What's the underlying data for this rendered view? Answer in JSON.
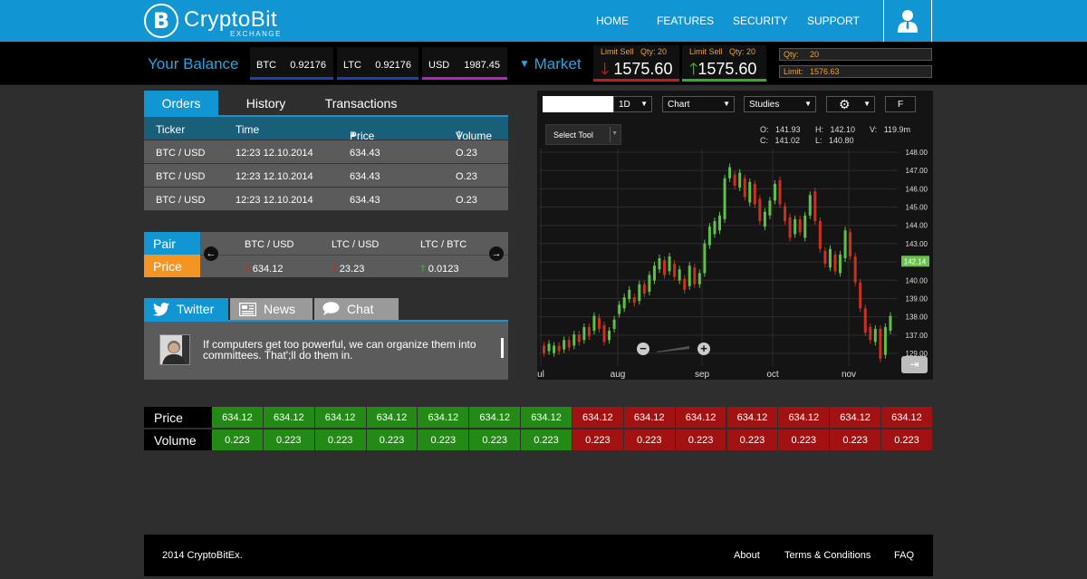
{
  "header": {
    "logo_symbol": "B",
    "logo_text": "CryptoBit",
    "logo_sub": "EXCHANGE",
    "nav": [
      "HOME",
      "FEATURES",
      "SECURITY",
      "SUPPORT"
    ]
  },
  "balance": {
    "title": "Your Balance",
    "items": [
      {
        "currency": "BTC",
        "amount": "0.92176",
        "color": "#1e3fb5"
      },
      {
        "currency": "LTC",
        "amount": "0.92176",
        "color": "#1e3fb5"
      },
      {
        "currency": "USD",
        "amount": "1987.45",
        "color": "#b522c8"
      }
    ],
    "market_label": "Market",
    "limit_sell": {
      "label": "Limit Sell",
      "qty": "Qty: 20",
      "value": "1575.60"
    },
    "limit_buy": {
      "label": "Limit Sell",
      "qty": "Qty: 20",
      "value": "1575.60"
    },
    "qty_field": {
      "label": "Qty:",
      "value": "20"
    },
    "limit_field": {
      "label": "Limit:",
      "value": "1576.63"
    }
  },
  "orders": {
    "tabs": [
      "Orders",
      "History",
      "Transactions"
    ],
    "columns": [
      "Ticker",
      "Time",
      "Price",
      "Volume"
    ],
    "rows": [
      [
        "BTC / USD",
        "12:23 12.10.2014",
        "634.43",
        "O.23"
      ],
      [
        "BTC / USD",
        "12:23 12.10.2014",
        "634.43",
        "O.23"
      ],
      [
        "BTC / USD",
        "12:23 12.10.2014",
        "634.43",
        "O.23"
      ]
    ]
  },
  "pairs": {
    "pair_label": "Pair",
    "price_label": "Price",
    "items": [
      {
        "pair": "BTC / USD",
        "price": "634.12",
        "dir": "down"
      },
      {
        "pair": "LTC / USD",
        "price": "23.23",
        "dir": "down"
      },
      {
        "pair": "LTC / BTC",
        "price": "0.0123",
        "dir": "up"
      }
    ]
  },
  "feed": {
    "tabs": [
      "Twitter",
      "News",
      "Chat"
    ],
    "message": "If computers get too powerful, we can organize them into committees. That';ll do them in."
  },
  "chart_controls": {
    "interval": "1D",
    "chart_type": "Chart",
    "studies": "Studies",
    "fullscreen": "F",
    "select_tool": "Select Tool",
    "ohlc": {
      "o": "141.93",
      "h": "142.10",
      "v": "119.9m",
      "c": "141.02",
      "l": "140.80"
    },
    "o_label": "O:",
    "h_label": "H:",
    "v_label": "V:",
    "c_label": "C:",
    "l_label": "L:"
  },
  "chart_data": {
    "type": "candlestick",
    "x_ticks": [
      "ul",
      "aug",
      "sep",
      "oct",
      "nov"
    ],
    "y_ticks": [
      "148.00",
      "147.00",
      "146.00",
      "145.00",
      "144.00",
      "143.00",
      "141.00",
      "140.00",
      "139.00",
      "138.00",
      "137.00",
      "129.00"
    ],
    "current_price": "142.14",
    "ylim": [
      136.5,
      148.1
    ],
    "candles": [
      {
        "o": 137.6,
        "c": 137.2
      },
      {
        "o": 137.3,
        "c": 137.7
      },
      {
        "o": 137.2,
        "c": 137.6
      },
      {
        "o": 137.6,
        "c": 137.3
      },
      {
        "o": 137.4,
        "c": 137.9
      },
      {
        "o": 137.9,
        "c": 137.5
      },
      {
        "o": 137.6,
        "c": 138.2
      },
      {
        "o": 138.2,
        "c": 137.8
      },
      {
        "o": 137.9,
        "c": 138.6
      },
      {
        "o": 138.6,
        "c": 138.1
      },
      {
        "o": 138.4,
        "c": 139.2
      },
      {
        "o": 139.1,
        "c": 138.5
      },
      {
        "o": 138.7,
        "c": 137.8
      },
      {
        "o": 137.9,
        "c": 138.4
      },
      {
        "o": 138.5,
        "c": 139.0
      },
      {
        "o": 139.3,
        "c": 139.8
      },
      {
        "o": 139.6,
        "c": 140.2
      },
      {
        "o": 140.1,
        "c": 140.6
      },
      {
        "o": 140.2,
        "c": 139.9
      },
      {
        "o": 140.0,
        "c": 140.9
      },
      {
        "o": 140.9,
        "c": 140.4
      },
      {
        "o": 140.5,
        "c": 141.4
      },
      {
        "o": 141.1,
        "c": 141.9
      },
      {
        "o": 141.7,
        "c": 142.3
      },
      {
        "o": 142.2,
        "c": 141.4
      },
      {
        "o": 141.6,
        "c": 142.4
      },
      {
        "o": 142.0,
        "c": 141.3
      },
      {
        "o": 141.1,
        "c": 141.7
      },
      {
        "o": 141.2,
        "c": 140.6
      },
      {
        "o": 140.8,
        "c": 141.9
      },
      {
        "o": 141.8,
        "c": 140.9
      },
      {
        "o": 140.9,
        "c": 141.5
      },
      {
        "o": 141.5,
        "c": 143.1
      },
      {
        "o": 143.0,
        "c": 144.0
      },
      {
        "o": 143.6,
        "c": 144.3
      },
      {
        "o": 143.8,
        "c": 144.6
      },
      {
        "o": 144.4,
        "c": 146.6
      },
      {
        "o": 146.6,
        "c": 147.2
      },
      {
        "o": 146.8,
        "c": 146.2
      },
      {
        "o": 146.1,
        "c": 146.9
      },
      {
        "o": 146.6,
        "c": 145.6
      },
      {
        "o": 145.3,
        "c": 146.4
      },
      {
        "o": 146.3,
        "c": 145.2
      },
      {
        "o": 145.5,
        "c": 144.3
      },
      {
        "o": 144.0,
        "c": 144.8
      },
      {
        "o": 144.6,
        "c": 145.4
      },
      {
        "o": 145.4,
        "c": 146.3
      },
      {
        "o": 146.5,
        "c": 145.2
      },
      {
        "o": 145.1,
        "c": 144.3
      },
      {
        "o": 144.5,
        "c": 143.4
      },
      {
        "o": 143.6,
        "c": 144.4
      },
      {
        "o": 144.4,
        "c": 143.7
      },
      {
        "o": 143.4,
        "c": 144.6
      },
      {
        "o": 144.6,
        "c": 145.7
      },
      {
        "o": 145.9,
        "c": 144.3
      },
      {
        "o": 144.3,
        "c": 142.8
      },
      {
        "o": 142.7,
        "c": 142.0
      },
      {
        "o": 141.8,
        "c": 142.8
      },
      {
        "o": 142.5,
        "c": 141.6
      },
      {
        "o": 141.5,
        "c": 142.5
      },
      {
        "o": 142.3,
        "c": 143.8
      },
      {
        "o": 143.7,
        "c": 142.4
      },
      {
        "o": 142.4,
        "c": 141.0
      },
      {
        "o": 141.0,
        "c": 139.6
      },
      {
        "o": 139.6,
        "c": 138.3
      },
      {
        "o": 138.6,
        "c": 137.9
      },
      {
        "o": 137.8,
        "c": 138.5
      },
      {
        "o": 138.5,
        "c": 136.9
      },
      {
        "o": 137.1,
        "c": 138.6
      },
      {
        "o": 138.4,
        "c": 139.2
      }
    ]
  },
  "orderbook": {
    "price_label": "Price",
    "volume_label": "Volume",
    "buy_prices": [
      "634.12",
      "634.12",
      "634.12",
      "634.12",
      "634.12",
      "634.12",
      "634.12"
    ],
    "buy_volumes": [
      "0.223",
      "0.223",
      "0.223",
      "0.223",
      "0.223",
      "0.223",
      "0.223"
    ],
    "sell_prices": [
      "634.12",
      "634.12",
      "634.12",
      "634.12",
      "634.12",
      "634.12",
      "634.12"
    ],
    "sell_volumes": [
      "0.223",
      "0.223",
      "0.223",
      "0.223",
      "0.223",
      "0.223",
      "0.223"
    ],
    "buy_color": "#248a16",
    "sell_color": "#a31212"
  },
  "footer": {
    "copyright": "2014  CryptoBitEx.",
    "links": [
      "About",
      "Terms & Conditions",
      "FAQ"
    ]
  }
}
